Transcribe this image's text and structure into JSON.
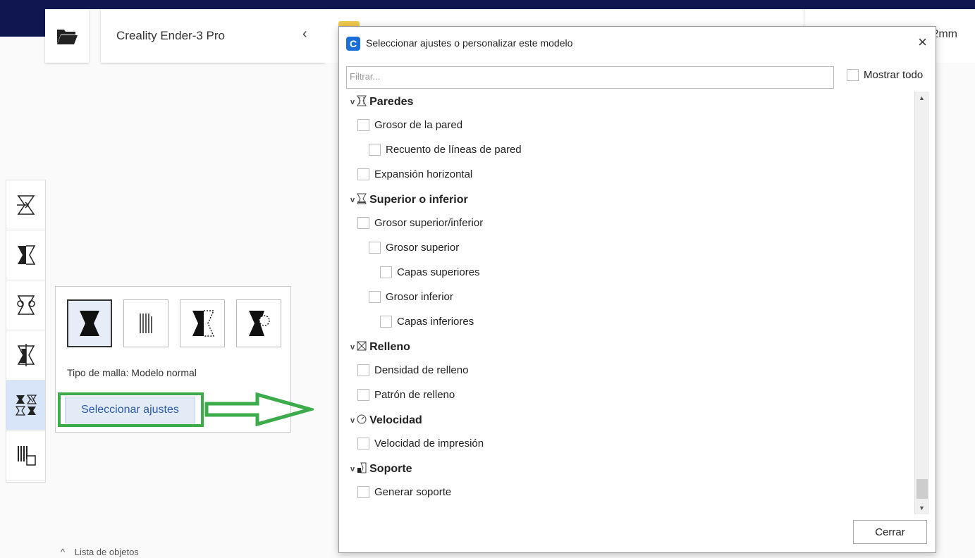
{
  "header": {
    "printer_name": "Creality Ender-3 Pro",
    "printer_chevron": "‹",
    "right_partial": ".2mm"
  },
  "tools": [
    {
      "name": "scale-tool"
    },
    {
      "name": "mirror-tool"
    },
    {
      "name": "rotate-tool"
    },
    {
      "name": "support-blocker-tool"
    },
    {
      "name": "per-model-settings-tool"
    },
    {
      "name": "mesh-tool"
    }
  ],
  "mesh_panel": {
    "type_label": "Tipo de malla: Modelo normal",
    "select_button": "Seleccionar ajustes",
    "annotation_color": "#3cab4c"
  },
  "object_list": {
    "chevron": "^",
    "label": "Lista de objetos"
  },
  "dialog": {
    "title": "Seleccionar ajustes o personalizar este modelo",
    "close_glyph": "×",
    "filter_placeholder": "Filtrar...",
    "show_all_label": "Mostrar todo",
    "close_button": "Cerrar",
    "accent": "#1d6fd8",
    "sections": [
      {
        "label": "Paredes",
        "icon": "walls-icon",
        "items": [
          {
            "label": "Grosor de la pared",
            "level": 1
          },
          {
            "label": "Recuento de líneas de pared",
            "level": 2
          },
          {
            "label": "Expansión horizontal",
            "level": 1
          }
        ]
      },
      {
        "label": "Superior o inferior",
        "icon": "top-bottom-icon",
        "items": [
          {
            "label": "Grosor superior/inferior",
            "level": 1
          },
          {
            "label": "Grosor superior",
            "level": 2
          },
          {
            "label": "Capas superiores",
            "level": 3
          },
          {
            "label": "Grosor inferior",
            "level": 2
          },
          {
            "label": "Capas inferiores",
            "level": 3
          }
        ]
      },
      {
        "label": "Relleno",
        "icon": "infill-icon",
        "items": [
          {
            "label": "Densidad de relleno",
            "level": 1
          },
          {
            "label": "Patrón de relleno",
            "level": 1
          }
        ]
      },
      {
        "label": "Velocidad",
        "icon": "speed-icon",
        "items": [
          {
            "label": "Velocidad de impresión",
            "level": 1
          }
        ]
      },
      {
        "label": "Soporte",
        "icon": "support-icon",
        "items": [
          {
            "label": "Generar soporte",
            "level": 1
          }
        ]
      }
    ]
  }
}
